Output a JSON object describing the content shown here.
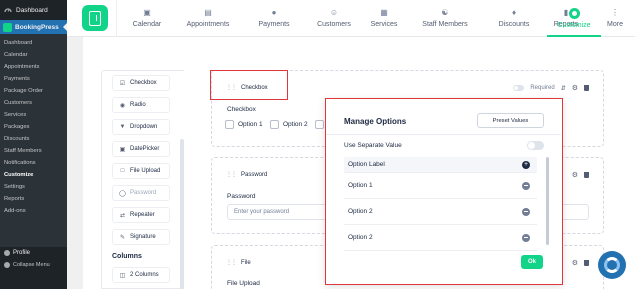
{
  "wp_menu": {
    "dashboard": "Dashboard",
    "plugin": "BookingPress",
    "submenu": [
      "Dashboard",
      "Calendar",
      "Appointments",
      "Payments",
      "Package Order",
      "Customers",
      "Services",
      "Packages",
      "Discounts",
      "Staff Members",
      "Notifications",
      "Customize",
      "Settings",
      "Reports",
      "Add-ons"
    ],
    "active_submenu": "Customize",
    "profile": "Profile",
    "collapse": "Collapse Menu"
  },
  "topnav": {
    "items": [
      {
        "label": "Calendar",
        "icon": "calendar-icon"
      },
      {
        "label": "Appointments",
        "icon": "appointments-icon"
      },
      {
        "label": "Payments",
        "icon": "payments-icon"
      },
      {
        "label": "Customers",
        "icon": "customers-icon"
      },
      {
        "label": "Services",
        "icon": "services-icon"
      },
      {
        "label": "Staff Members",
        "icon": "staff-icon"
      },
      {
        "label": "Discounts",
        "icon": "discount-icon"
      },
      {
        "label": "Reports",
        "icon": "reports-icon"
      },
      {
        "label": "Customize",
        "icon": "customize-icon"
      },
      {
        "label": "More",
        "icon": "more-icon"
      }
    ],
    "active": "Customize"
  },
  "field_list": {
    "items": [
      {
        "label": "Checkbox",
        "icon": "checkbox-icon",
        "disabled": false
      },
      {
        "label": "Radio",
        "icon": "radio-icon",
        "disabled": false
      },
      {
        "label": "Dropdown",
        "icon": "dropdown-icon",
        "disabled": false
      },
      {
        "label": "DatePicker",
        "icon": "datepicker-icon",
        "disabled": false
      },
      {
        "label": "File Upload",
        "icon": "file-upload-icon",
        "disabled": false
      },
      {
        "label": "Password",
        "icon": "password-icon",
        "disabled": true
      },
      {
        "label": "Repeater",
        "icon": "repeater-icon",
        "disabled": false
      },
      {
        "label": "Signature",
        "icon": "signature-icon",
        "disabled": false
      }
    ],
    "columns_title": "Columns",
    "columns_item": "2 Columns"
  },
  "canvas": {
    "checkbox_block": {
      "title": "Checkbox",
      "required_label": "Required",
      "field_label": "Checkbox",
      "options": [
        "Option 1",
        "Option 2"
      ]
    },
    "password_block": {
      "title": "Password",
      "field_label": "Password",
      "placeholder": "Enter your password"
    },
    "file_block": {
      "title": "File",
      "field_label": "File Upload"
    }
  },
  "modal": {
    "title": "Manage Options",
    "preset_button": "Preset Values",
    "separate_value_label": "Use Separate Value",
    "table_header": "Option Label",
    "options": [
      "Option 1",
      "Option 2",
      "Option 2"
    ],
    "ok_button": "Ok"
  }
}
